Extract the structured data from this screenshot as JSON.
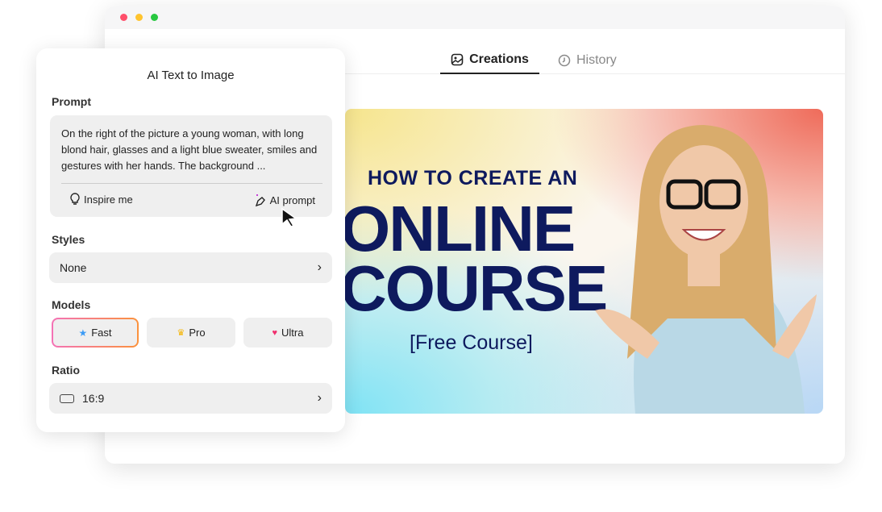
{
  "window": {
    "dots": [
      "#ff5f57",
      "#febc2e",
      "#28c840"
    ]
  },
  "tabs": [
    {
      "label": "Creations",
      "icon": "image-icon"
    },
    {
      "label": "History",
      "icon": "clock-icon"
    }
  ],
  "hero": {
    "line1": "HOW TO CREATE AN",
    "line2": "ONLINE",
    "line3": "COURSE",
    "line4": "[Free Course]"
  },
  "panel": {
    "title": "AI Text to Image",
    "prompt_label": "Prompt",
    "prompt_text": "On the right of the picture a young woman, with long blond hair, glasses and a light blue sweater, smiles and gestures with her hands. The background ...",
    "inspire": "Inspire me",
    "ai_prompt": "AI prompt",
    "styles_label": "Styles",
    "style_value": "None",
    "models_label": "Models",
    "models": [
      {
        "label": "Fast",
        "selected": true
      },
      {
        "label": "Pro"
      },
      {
        "label": "Ultra"
      }
    ],
    "ratio_label": "Ratio",
    "ratio_value": "16:9"
  }
}
